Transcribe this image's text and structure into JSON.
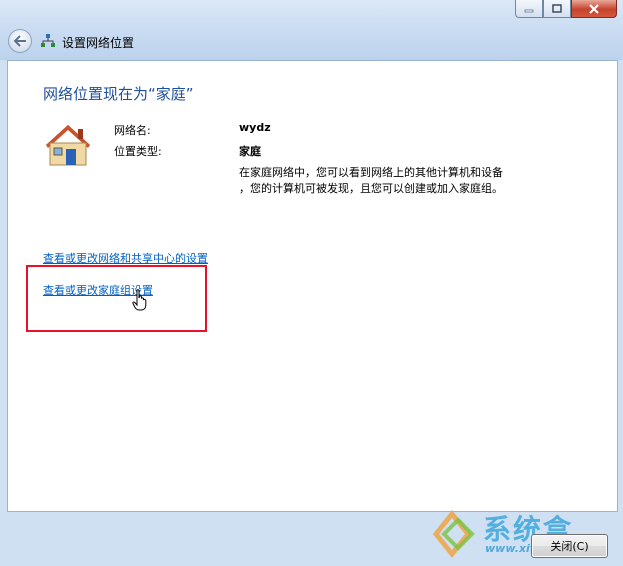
{
  "window": {
    "title": "设置网络位置"
  },
  "heading": "网络位置现在为“家庭”",
  "info": {
    "network_name_label": "网络名:",
    "network_name_value": "wydz",
    "location_type_label": "位置类型:",
    "location_type_value": "家庭",
    "description_line1": "在家庭网络中，您可以看到网络上的其他计算机和设备",
    "description_line2": "，您的计算机可被发现，且您可以创建或加入家庭组。"
  },
  "links": {
    "network_sharing": "查看或更改网络和共享中心的设置",
    "homegroup": "查看或更改家庭组设置"
  },
  "buttons": {
    "close": "关闭(C)"
  },
  "watermark": {
    "brand": "系统盒",
    "url": "www.xitonghe.com"
  },
  "colors": {
    "heading": "#1e4f9c",
    "link": "#0060c0",
    "highlight_box": "#e8102a"
  }
}
